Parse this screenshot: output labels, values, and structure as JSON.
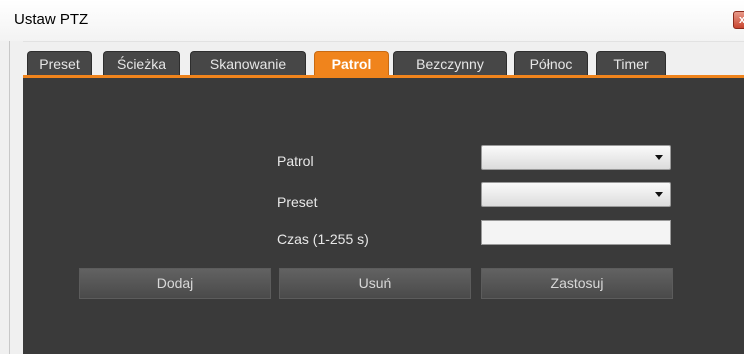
{
  "window": {
    "title": "Ustaw PTZ",
    "close_glyph": "x"
  },
  "tabs": [
    {
      "label": "Preset",
      "active": false
    },
    {
      "label": "Ścieżka",
      "active": false
    },
    {
      "label": "Skanowanie",
      "active": false
    },
    {
      "label": "Patrol",
      "active": true
    },
    {
      "label": "Bezczynny",
      "active": false
    },
    {
      "label": "Północ",
      "active": false
    },
    {
      "label": "Timer",
      "active": false
    }
  ],
  "form": {
    "patrol_label": "Patrol",
    "patrol_value": "",
    "preset_label": "Preset",
    "preset_value": "",
    "time_label": "Czas (1-255 s)",
    "time_value": ""
  },
  "buttons": {
    "add": "Dodaj",
    "delete": "Usuń",
    "apply": "Zastosuj"
  },
  "colors": {
    "accent": "#f0841c",
    "panel": "#3a3a3a",
    "tab": "#474747"
  }
}
